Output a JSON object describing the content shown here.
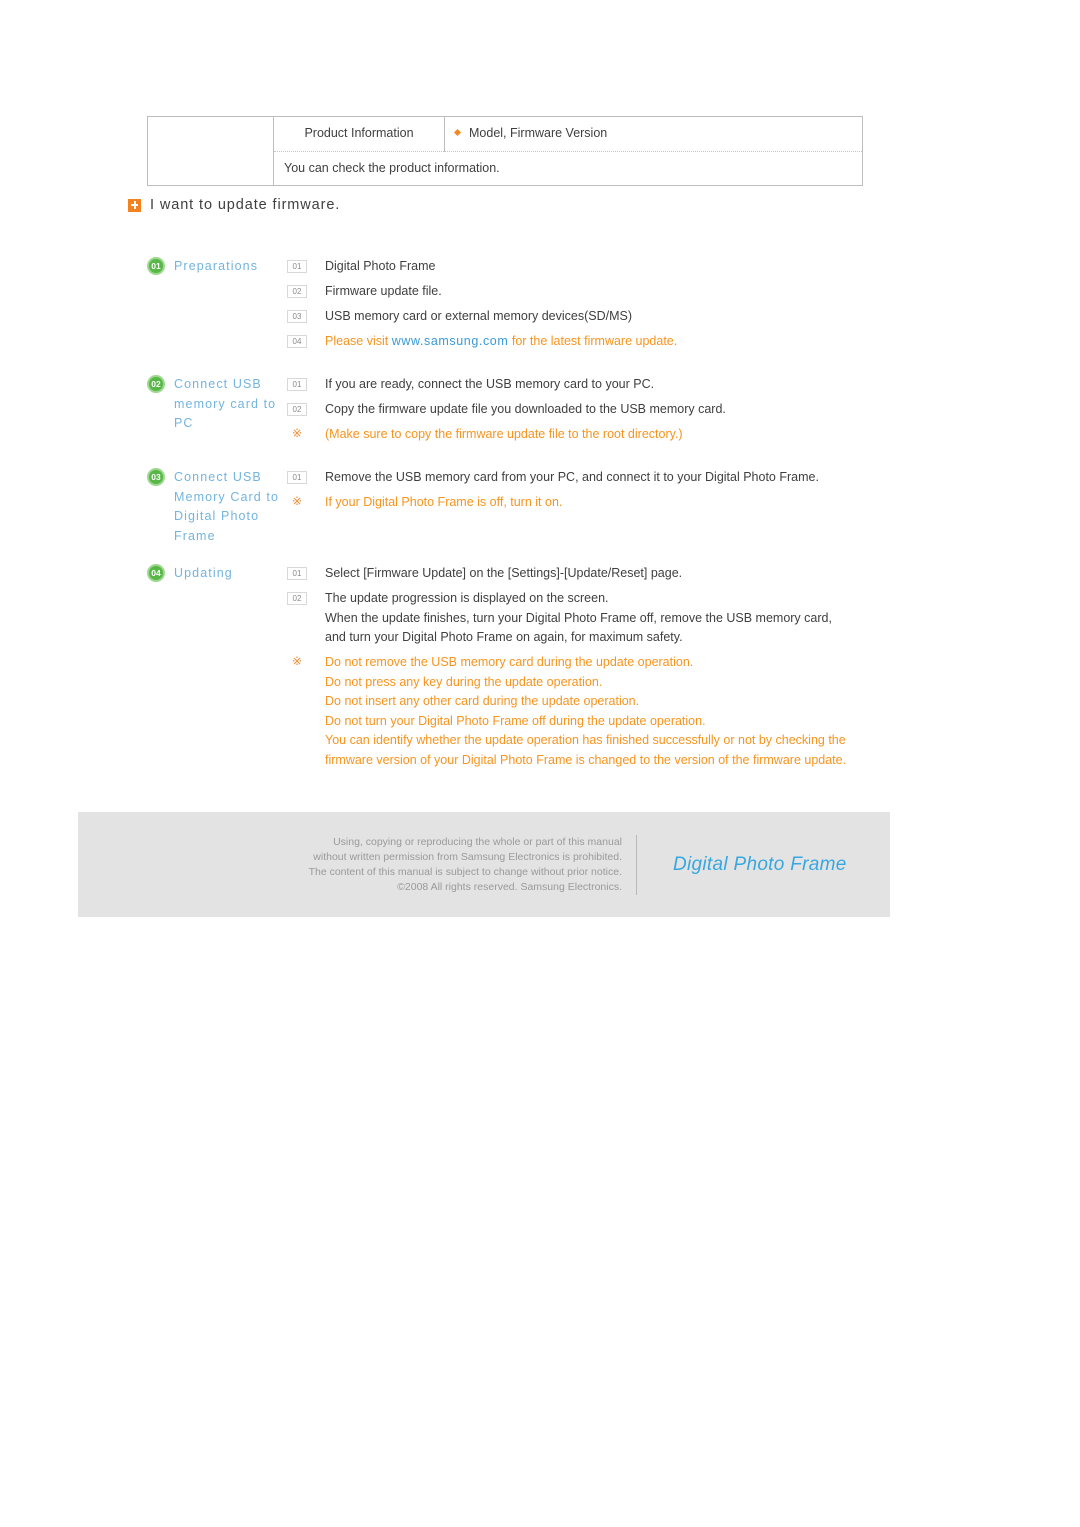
{
  "table": {
    "empty_cell": "",
    "label": "Product Information",
    "value": "Model, Firmware Version",
    "description": "You can check the product information."
  },
  "heading": {
    "icon": "plus-square-icon",
    "text": "I want to update firmware."
  },
  "steps": [
    {
      "badge": "01",
      "title": "Preparations",
      "items": [
        {
          "marker": "01",
          "type": "number",
          "color": "dark",
          "lines": [
            "Digital Photo Frame"
          ]
        },
        {
          "marker": "02",
          "type": "number",
          "color": "dark",
          "lines": [
            "Firmware update file."
          ]
        },
        {
          "marker": "03",
          "type": "number",
          "color": "dark",
          "lines": [
            "USB memory card or external memory devices(SD/MS)"
          ]
        },
        {
          "marker": "04",
          "type": "number",
          "color": "orange",
          "lines": [],
          "rich": {
            "pre": "Please visit ",
            "link": "www.samsung.com",
            "post": " for the latest firmware update."
          }
        }
      ]
    },
    {
      "badge": "02",
      "title": "Connect USB memory card to PC",
      "items": [
        {
          "marker": "01",
          "type": "number",
          "color": "dark",
          "lines": [
            "If you are ready, connect the USB memory card to your PC."
          ]
        },
        {
          "marker": "02",
          "type": "number",
          "color": "dark",
          "lines": [
            "Copy the firmware update file you downloaded to the USB memory card."
          ]
        },
        {
          "marker": "※",
          "type": "note",
          "color": "orange",
          "lines": [
            "(Make sure to copy the firmware update file to the root directory.)"
          ]
        }
      ]
    },
    {
      "badge": "03",
      "title": "Connect USB Memory Card to Digital Photo Frame",
      "items": [
        {
          "marker": "01",
          "type": "number",
          "color": "dark",
          "lines": [
            "Remove the USB memory card from your PC, and connect it to your Digital Photo Frame."
          ]
        },
        {
          "marker": "※",
          "type": "note",
          "color": "orange",
          "lines": [
            "If your Digital Photo Frame is off, turn it on."
          ]
        }
      ]
    },
    {
      "badge": "04",
      "title": "Updating",
      "items": [
        {
          "marker": "01",
          "type": "number",
          "color": "dark",
          "lines": [
            "Select [Firmware Update] on the [Settings]-[Update/Reset] page."
          ]
        },
        {
          "marker": "02",
          "type": "number",
          "color": "dark",
          "lines": [
            "The update progression is displayed on the screen.",
            "When the update finishes, turn your Digital Photo Frame off, remove the USB memory card,",
            "and turn your Digital Photo Frame on again, for maximum safety."
          ]
        },
        {
          "marker": "※",
          "type": "note",
          "color": "orange",
          "lines": [
            "Do not remove the USB memory card during the update operation.",
            "Do not press any key during the update operation.",
            "Do not insert any other card during the update operation.",
            "Do not turn your Digital Photo Frame off during the update operation.",
            "You can identify whether the update operation has finished successfully or not by checking the",
            "firmware version of your Digital Photo Frame is changed to the version of the firmware update."
          ]
        }
      ]
    }
  ],
  "footer": {
    "copyright_lines": [
      "Using, copying or reproducing the whole or part of this manual",
      "without written permission from Samsung Electronics is prohibited.",
      "The content of this manual is subject to change without prior notice.",
      "©2008 All rights reserved. Samsung Electronics."
    ],
    "brand": "Digital Photo Frame"
  },
  "colors": {
    "orange": "#f7941e",
    "blue": "#73b4e0",
    "link_blue": "#3a9ad9",
    "green": "#57b847",
    "footer_bg": "#e3e3e3",
    "body_text": "#3f3f3f"
  }
}
